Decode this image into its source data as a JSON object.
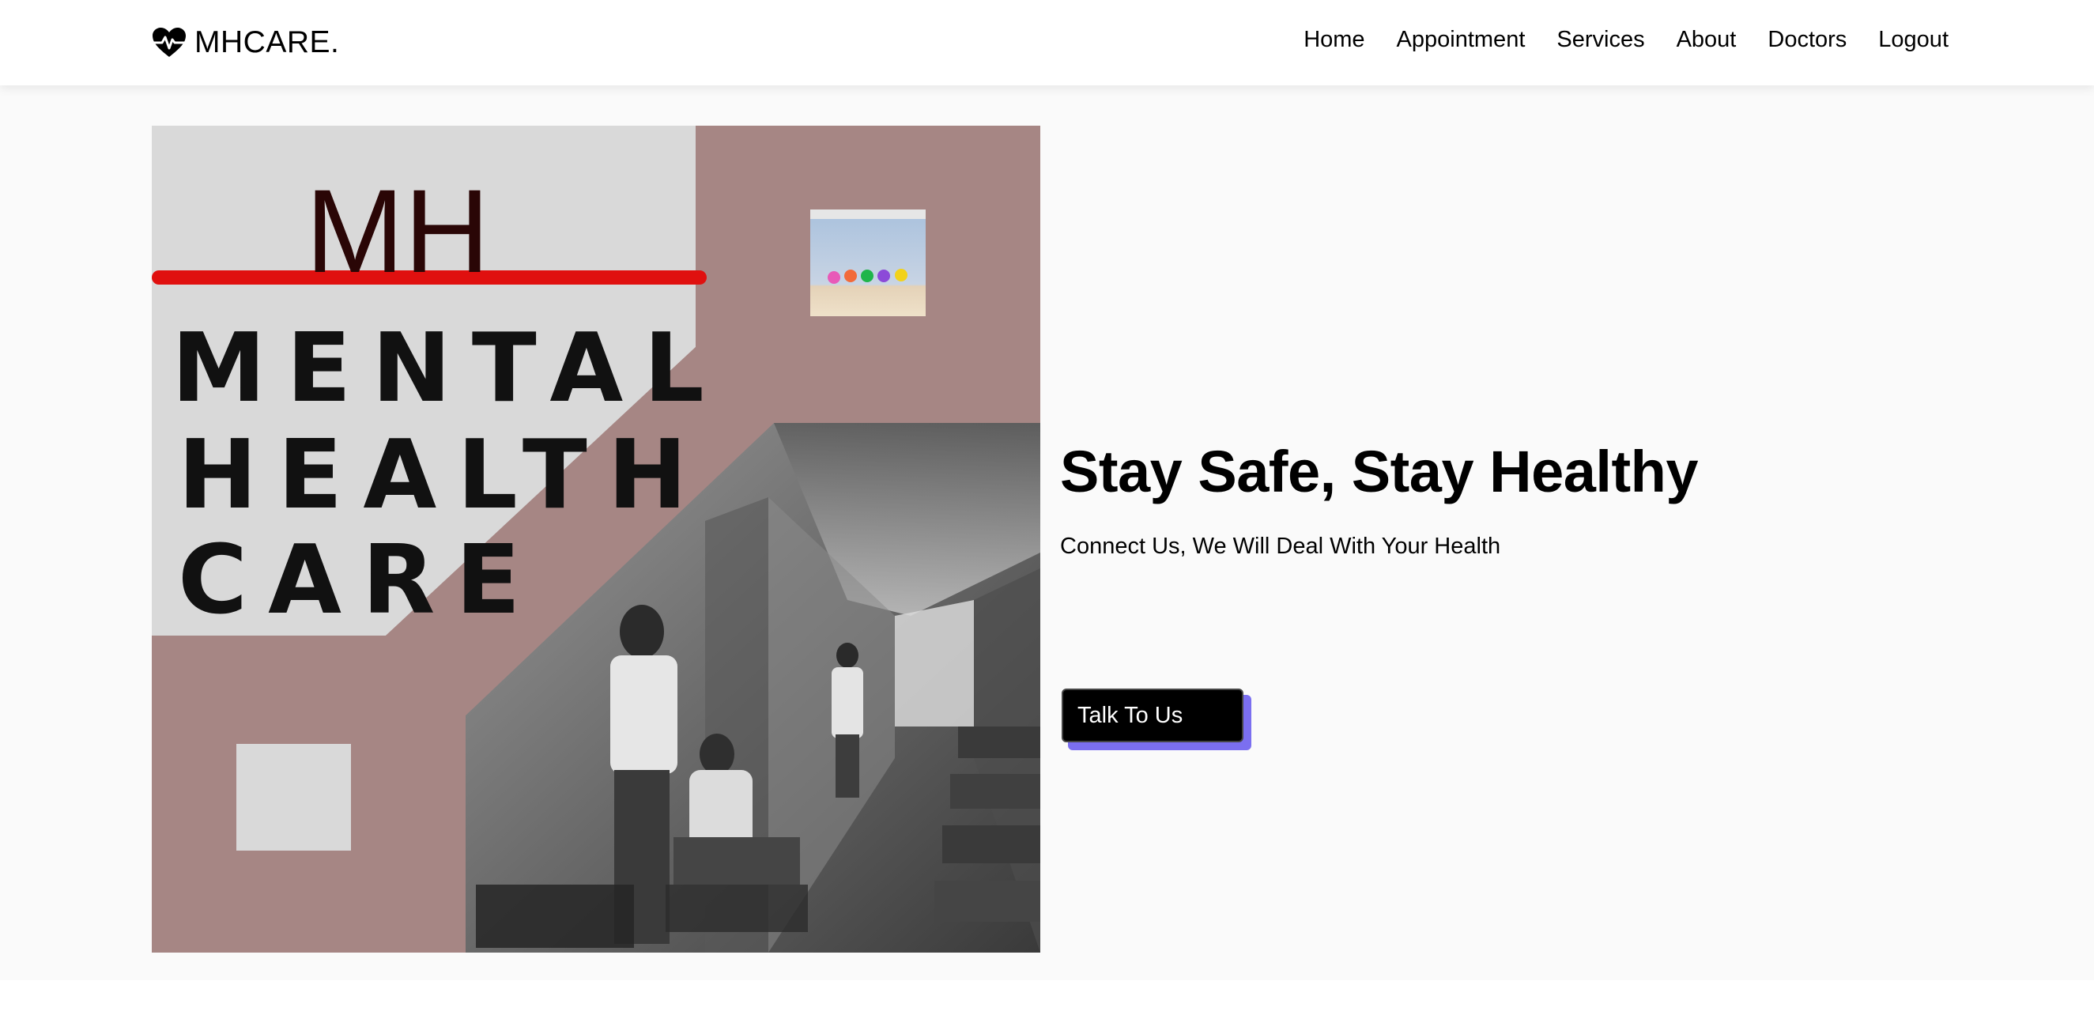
{
  "brand": {
    "name": "MHCARE.",
    "icon": "heartbeat-icon"
  },
  "nav": {
    "items": [
      {
        "label": "Home"
      },
      {
        "label": "Appointment"
      },
      {
        "label": "Services"
      },
      {
        "label": "About"
      },
      {
        "label": "Doctors"
      },
      {
        "label": "Logout"
      }
    ]
  },
  "hero": {
    "title": "Stay Safe, Stay Healthy",
    "subtitle": "Connect Us, We Will Deal With Your Health",
    "cta_label": "Talk To Us",
    "accent_color": "#7b6ff0"
  },
  "poster": {
    "monogram": "MH",
    "line1": "MENTAL",
    "line2": "HEALTH",
    "line3": "CARE",
    "colors": {
      "mauve": "#a68684",
      "light_gray": "#d9d9d9",
      "red_bar": "#e0100f",
      "monogram": "#2a0606"
    }
  }
}
